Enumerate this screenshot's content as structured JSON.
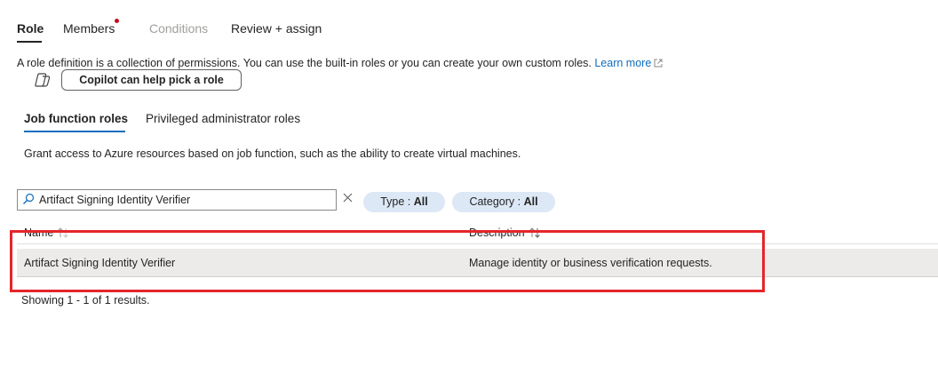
{
  "tabs": [
    {
      "label": "Role",
      "state": "active"
    },
    {
      "label": "Members",
      "state": "normal"
    },
    {
      "label": "Conditions",
      "state": "disabled"
    },
    {
      "label": "Review + assign",
      "state": "normal"
    }
  ],
  "intro": {
    "text": "A role definition is a collection of permissions. You can use the built-in roles or you can create your own custom roles. ",
    "link": "Learn more"
  },
  "copilot": {
    "button_label": "Copilot can help pick a role"
  },
  "subtabs": [
    {
      "label": "Job function roles",
      "state": "active"
    },
    {
      "label": "Privileged administrator roles",
      "state": "normal"
    }
  ],
  "description": "Grant access to Azure resources based on job function, such as the ability to create virtual machines.",
  "search": {
    "value": "Artifact Signing Identity Verifier",
    "placeholder": ""
  },
  "filters": {
    "type": {
      "label": "Type : ",
      "value": "All"
    },
    "category": {
      "label": "Category : ",
      "value": "All"
    }
  },
  "table": {
    "columns": [
      "Name",
      "Description"
    ],
    "rows": [
      {
        "name": "Artifact Signing Identity Verifier",
        "description": "Manage identity or business verification requests."
      }
    ]
  },
  "results": "Showing 1 - 1 of 1 results.",
  "colors": {
    "accent": "#0f6cbd",
    "highlight": "#e3262b",
    "notification_dot": "#c50f1f",
    "pill_background": "#dde8f6",
    "row_selected": "#edebe9"
  },
  "icons": {
    "copilot": "copilot-icon",
    "search": "search-icon",
    "clear": "close-icon",
    "external_link": "external-link-icon",
    "sort": "sort-icon"
  }
}
